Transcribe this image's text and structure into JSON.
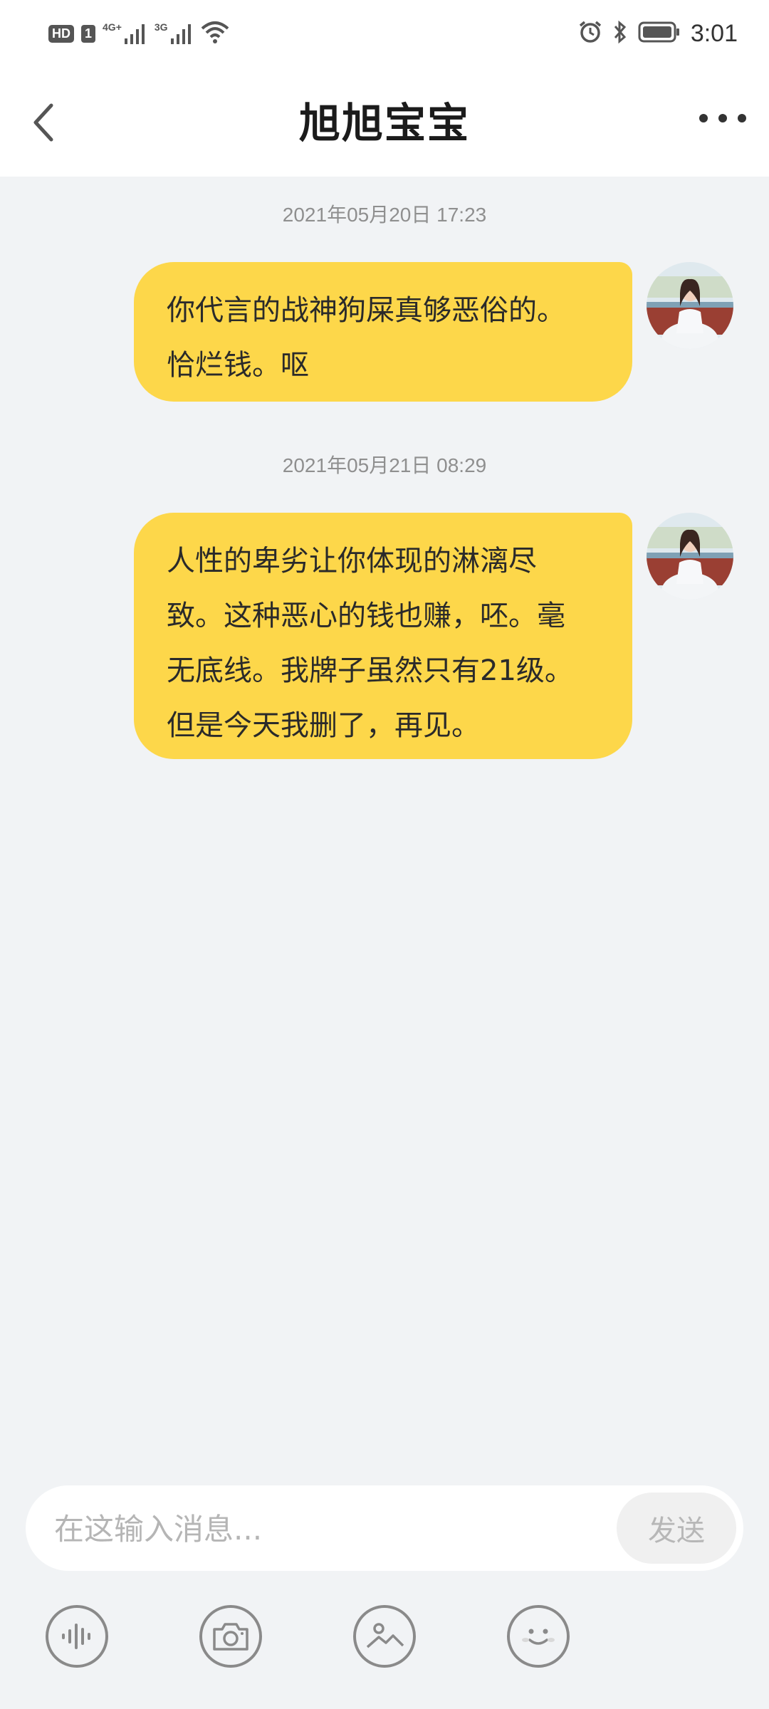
{
  "status_bar": {
    "time": "3:01",
    "left_icons": [
      "hd-icon",
      "sim1-icon",
      "signal-4g-icon",
      "signal-3g-icon",
      "wifi-icon"
    ],
    "left_labels": {
      "hd": "HD",
      "sim": "1",
      "net1": "4G+",
      "net2": "3G"
    },
    "right_icons": [
      "alarm-icon",
      "bluetooth-icon",
      "battery-icon"
    ]
  },
  "header": {
    "title": "旭旭宝宝",
    "back_icon": "chevron-left-icon",
    "more_icon": "more-icon"
  },
  "messages": [
    {
      "timestamp": "2021年05月20日 17:23",
      "lines": [
        "你代言的战神狗屎真够恶俗的。",
        "恰烂钱。呕"
      ]
    },
    {
      "timestamp": "2021年05月21日 08:29",
      "lines": [
        "人性的卑劣让你体现的淋漓尽",
        "致。这种恶心的钱也赚，呸。毫",
        "无底线。我牌子虽然只有21级。",
        "但是今天我删了，再见。"
      ]
    }
  ],
  "input": {
    "placeholder": "在这输入消息...",
    "value": "",
    "send_label": "发送"
  },
  "toolbar": {
    "icons": [
      "voice-icon",
      "camera-icon",
      "image-icon",
      "emoji-icon"
    ]
  },
  "colors": {
    "bubble": "#fdd74a",
    "background": "#f1f3f5",
    "header": "#ffffff"
  }
}
